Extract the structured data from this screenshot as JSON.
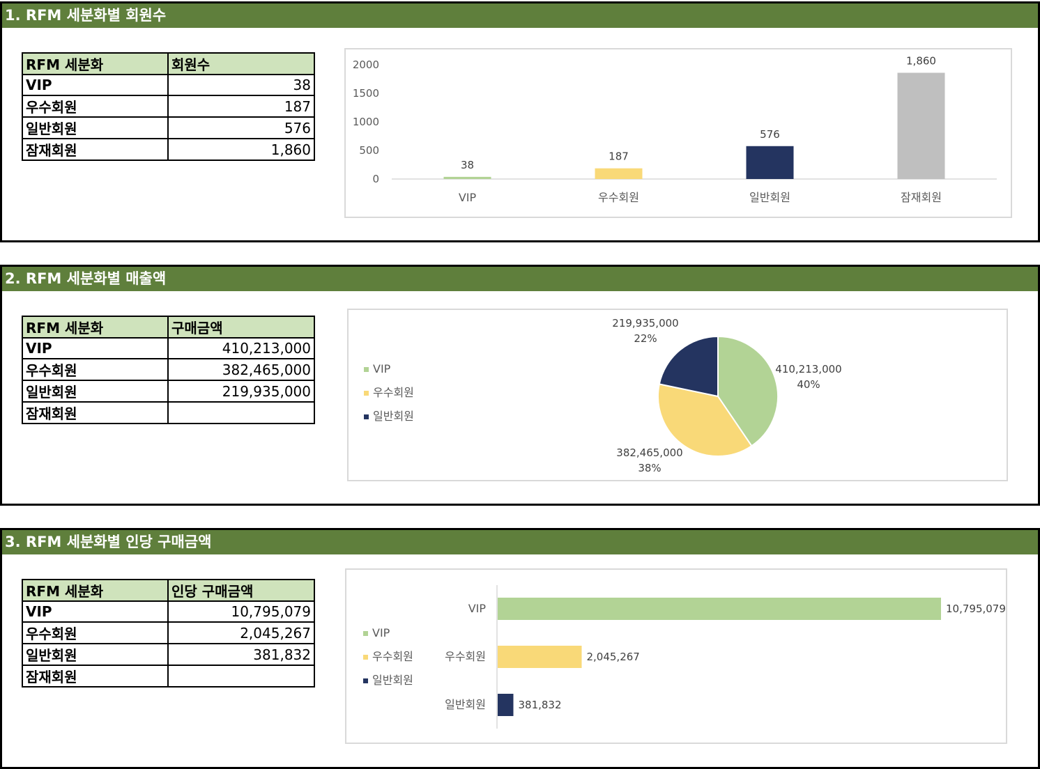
{
  "sections": [
    {
      "title": "1. RFM 세분화별 회원수",
      "table": {
        "headers": [
          "RFM 세분화",
          "회원수"
        ],
        "rows": [
          {
            "label": "VIP",
            "value": "38"
          },
          {
            "label": "우수회원",
            "value": "187"
          },
          {
            "label": "일반회원",
            "value": "576"
          },
          {
            "label": "잠재회원",
            "value": "1,860"
          }
        ]
      }
    },
    {
      "title": "2. RFM 세분화별 매출액",
      "table": {
        "headers": [
          "RFM 세분화",
          "구매금액"
        ],
        "rows": [
          {
            "label": "VIP",
            "value": "410,213,000"
          },
          {
            "label": "우수회원",
            "value": "382,465,000"
          },
          {
            "label": "일반회원",
            "value": "219,935,000"
          },
          {
            "label": "잠재회원",
            "value": ""
          }
        ]
      }
    },
    {
      "title": "3. RFM 세분화별 인당 구매금액",
      "table": {
        "headers": [
          "RFM 세분화",
          "인당 구매금액"
        ],
        "rows": [
          {
            "label": "VIP",
            "value": "10,795,079"
          },
          {
            "label": "우수회원",
            "value": "2,045,267"
          },
          {
            "label": "일반회원",
            "value": "381,832"
          },
          {
            "label": "잠재회원",
            "value": ""
          }
        ]
      }
    }
  ],
  "chart_data": [
    {
      "type": "bar",
      "categories": [
        "VIP",
        "우수회원",
        "일반회원",
        "잠재회원"
      ],
      "values": [
        38,
        187,
        576,
        1860
      ],
      "data_labels": [
        "38",
        "187",
        "576",
        "1,860"
      ],
      "colors": [
        "#b2d395",
        "#f9d978",
        "#243460",
        "#bfbfbf"
      ],
      "yticks": [
        "0",
        "500",
        "1000",
        "1500",
        "2000"
      ],
      "ylim": [
        0,
        2000
      ],
      "grid": false,
      "legend": "none"
    },
    {
      "type": "pie",
      "labels": [
        "VIP",
        "우수회원",
        "일반회원"
      ],
      "values": [
        410213000,
        382465000,
        219935000
      ],
      "value_labels": [
        "410,213,000",
        "382,465,000",
        "219,935,000"
      ],
      "percent_labels": [
        "40%",
        "38%",
        "22%"
      ],
      "colors": [
        "#b2d395",
        "#f9d978",
        "#243460"
      ],
      "legend": "left"
    },
    {
      "type": "bar",
      "orientation": "horizontal",
      "categories": [
        "VIP",
        "우수회원",
        "일반회원"
      ],
      "values": [
        10795079,
        2045267,
        381832
      ],
      "data_labels": [
        "10,795,079",
        "2,045,267",
        "381,832"
      ],
      "colors": [
        "#b2d395",
        "#f9d978",
        "#243460"
      ],
      "legend": "left",
      "legend_labels": [
        "VIP",
        "우수회원",
        "일반회원"
      ]
    }
  ]
}
